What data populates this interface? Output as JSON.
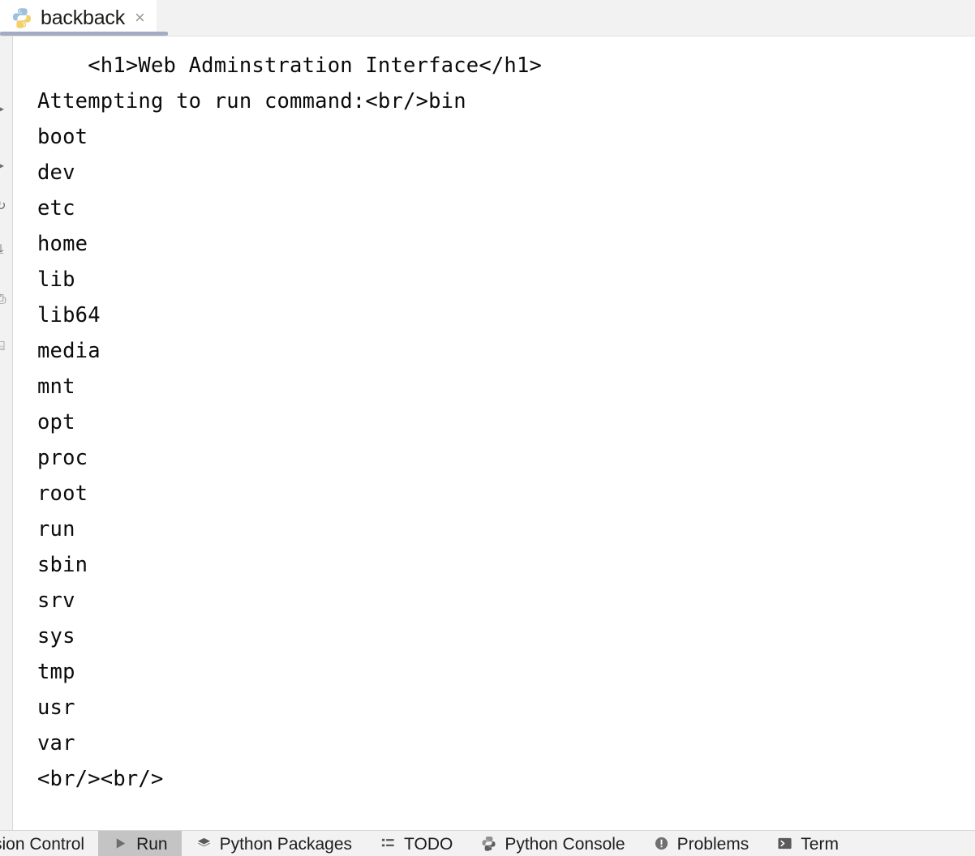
{
  "window": {
    "editor_tab": {
      "label": "backback",
      "icon": "python-file-icon",
      "close_label": "×"
    }
  },
  "console": {
    "lines": [
      "    <h1>Web Adminstration Interface</h1>",
      "",
      "Attempting to run command:<br/>bin",
      "boot",
      "dev",
      "etc",
      "home",
      "lib",
      "lib64",
      "media",
      "mnt",
      "opt",
      "proc",
      "root",
      "run",
      "sbin",
      "srv",
      "sys",
      "tmp",
      "usr",
      "var",
      "<br/><br/>"
    ]
  },
  "run_toolstrip": {
    "items": [
      {
        "name": "expand-arrow-icon",
        "glyph": "▸"
      },
      {
        "name": "collapse-arrow-icon",
        "glyph": "▸"
      },
      {
        "name": "rerun-icon",
        "glyph": "↻"
      },
      {
        "name": "scroll-to-end-icon",
        "glyph": "⤓"
      },
      {
        "name": "print-icon",
        "glyph": "⎙"
      },
      {
        "name": "clear-all-icon",
        "glyph": "⌸"
      }
    ]
  },
  "bottom_bar": {
    "items": [
      {
        "label": "sion Control",
        "icon": "version-control-icon",
        "active": false
      },
      {
        "label": "Run",
        "icon": "run-play-icon",
        "active": true
      },
      {
        "label": "Python Packages",
        "icon": "packages-layers-icon",
        "active": false
      },
      {
        "label": "TODO",
        "icon": "todo-list-icon",
        "active": false
      },
      {
        "label": "Python Console",
        "icon": "python-console-icon",
        "active": false
      },
      {
        "label": "Problems",
        "icon": "problems-warning-icon",
        "active": false
      },
      {
        "label": "Term",
        "icon": "terminal-icon",
        "active": false
      }
    ]
  },
  "colors": {
    "tab_underline": "#a3acc2",
    "active_tool_bg": "#c4c4c4",
    "console_bg": "#ffffff",
    "chrome_bg": "#f2f2f2",
    "text": "#1d1d1d"
  }
}
